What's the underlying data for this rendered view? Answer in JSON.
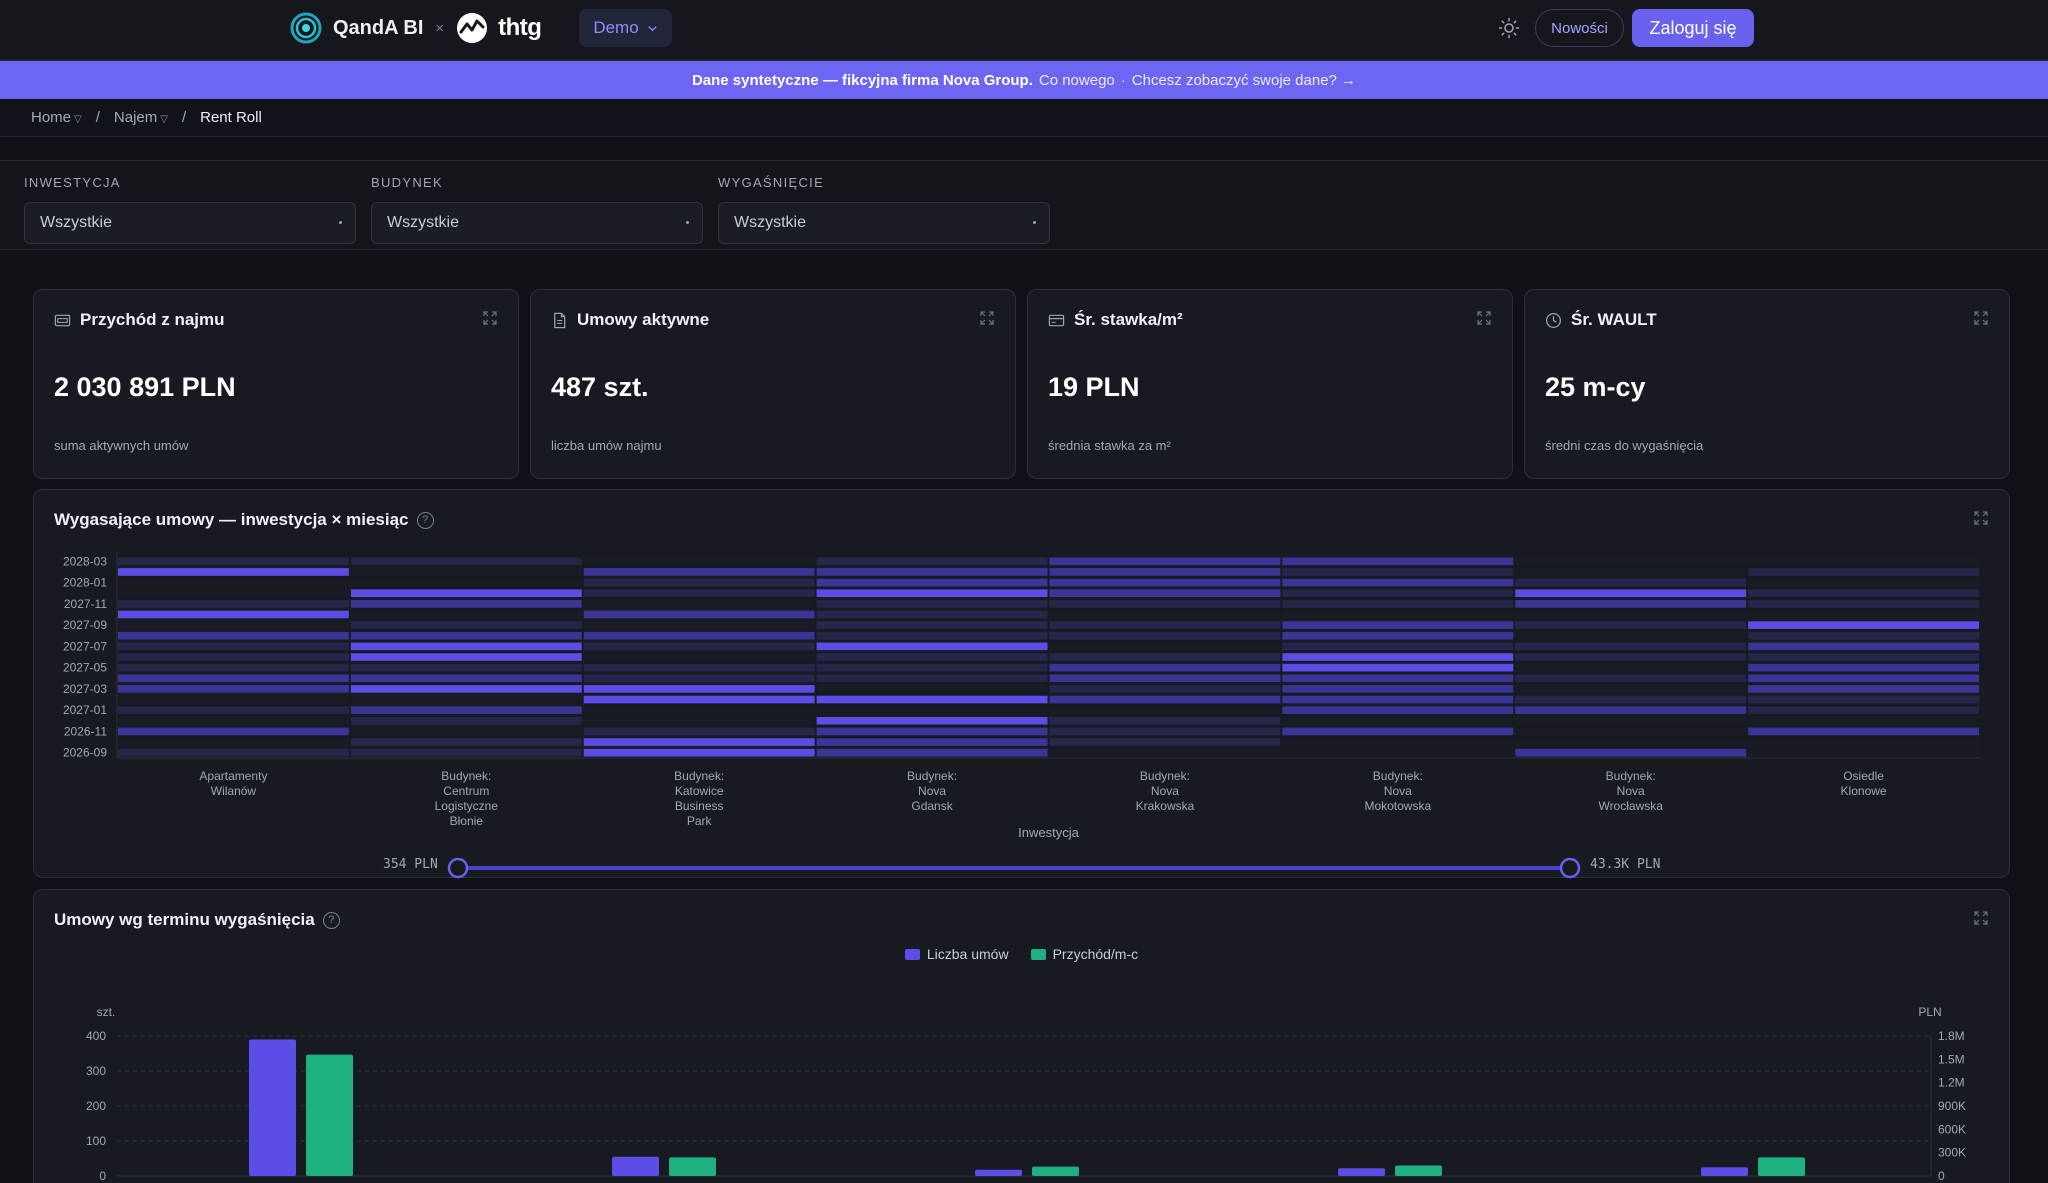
{
  "header": {
    "brand": "QandA BI",
    "times": "×",
    "partner": "thtg",
    "demo_label": "Demo",
    "news_label": "Nowości",
    "login_label": "Zaloguj się"
  },
  "banner": {
    "text": "Dane syntetyczne — fikcyjna firma Nova Group.",
    "link1": "Co nowego",
    "separator": "·",
    "link2": "Chcesz zobaczyć swoje dane? →"
  },
  "breadcrumb": {
    "items": [
      "Home",
      "Najem",
      "Rent Roll"
    ],
    "separator": "/"
  },
  "filters": [
    {
      "label": "INWESTYCJA",
      "value": "Wszystkie"
    },
    {
      "label": "BUDYNEK",
      "value": "Wszystkie"
    },
    {
      "label": "WYGAŚNIĘCIE",
      "value": "Wszystkie"
    }
  ],
  "kpis": [
    {
      "title": "Przychód z najmu",
      "value": "2 030 891 PLN",
      "sub": "suma aktywnych umów",
      "icon": "wallet-icon"
    },
    {
      "title": "Umowy aktywne",
      "value": "487 szt.",
      "sub": "liczba umów najmu",
      "icon": "document-icon"
    },
    {
      "title": "Śr. stawka/m²",
      "value": "19 PLN",
      "sub": "średnia stawka za m²",
      "icon": "card-icon"
    },
    {
      "title": "Śr. WAULT",
      "value": "25 m-cy",
      "sub": "średni czas do wygaśnięcia",
      "icon": "clock-icon"
    }
  ],
  "heatmap": {
    "title": "Wygasające umowy — inwestycja × miesiąc",
    "xlabel": "Inwestycja",
    "y_ticks": [
      "2028-03",
      "2028-01",
      "2027-11",
      "2027-09",
      "2027-07",
      "2027-05",
      "2027-03",
      "2027-01",
      "2026-11",
      "2026-09"
    ],
    "categories": [
      [
        "Apartamenty",
        "Wilanów"
      ],
      [
        "Budynek:",
        "Centrum",
        "Logistyczne",
        "Błonie"
      ],
      [
        "Budynek:",
        "Katowice",
        "Business",
        "Park"
      ],
      [
        "Budynek:",
        "Nova",
        "Gdansk"
      ],
      [
        "Budynek:",
        "Nova",
        "Krakowska"
      ],
      [
        "Budynek:",
        "Nova",
        "Mokotowska"
      ],
      [
        "Budynek:",
        "Nova",
        "Wrocławska"
      ],
      [
        "Osiedle",
        "Klonowe"
      ]
    ],
    "slider_min": "354 PLN",
    "slider_max": "43.3K PLN",
    "colors": {
      "high": "#5b4de6",
      "mid": "#3a3596",
      "low": "#25264a",
      "empty": "#1a1c25"
    }
  },
  "chart_data": {
    "type": "bar",
    "title": "Umowy wg terminu wygaśnięcia",
    "series": [
      {
        "name": "Liczba umów",
        "color": "#5b4de6",
        "values": [
          390,
          55,
          18,
          22,
          25
        ]
      },
      {
        "name": "Przychód/m-c",
        "color": "#1fb07f",
        "values": [
          1560000,
          240000,
          120000,
          135000,
          240000
        ]
      }
    ],
    "left_unit": "szt.",
    "right_unit": "PLN",
    "left_ticks": [
      "400",
      "300",
      "200",
      "100",
      "0"
    ],
    "right_ticks": [
      "1.8M",
      "1.5M",
      "1.2M",
      "900K",
      "600K",
      "300K",
      "0"
    ],
    "left_ylim": [
      0,
      400
    ],
    "right_ylim": [
      0,
      1800000
    ],
    "legend_position": "top-center",
    "grid": true
  }
}
